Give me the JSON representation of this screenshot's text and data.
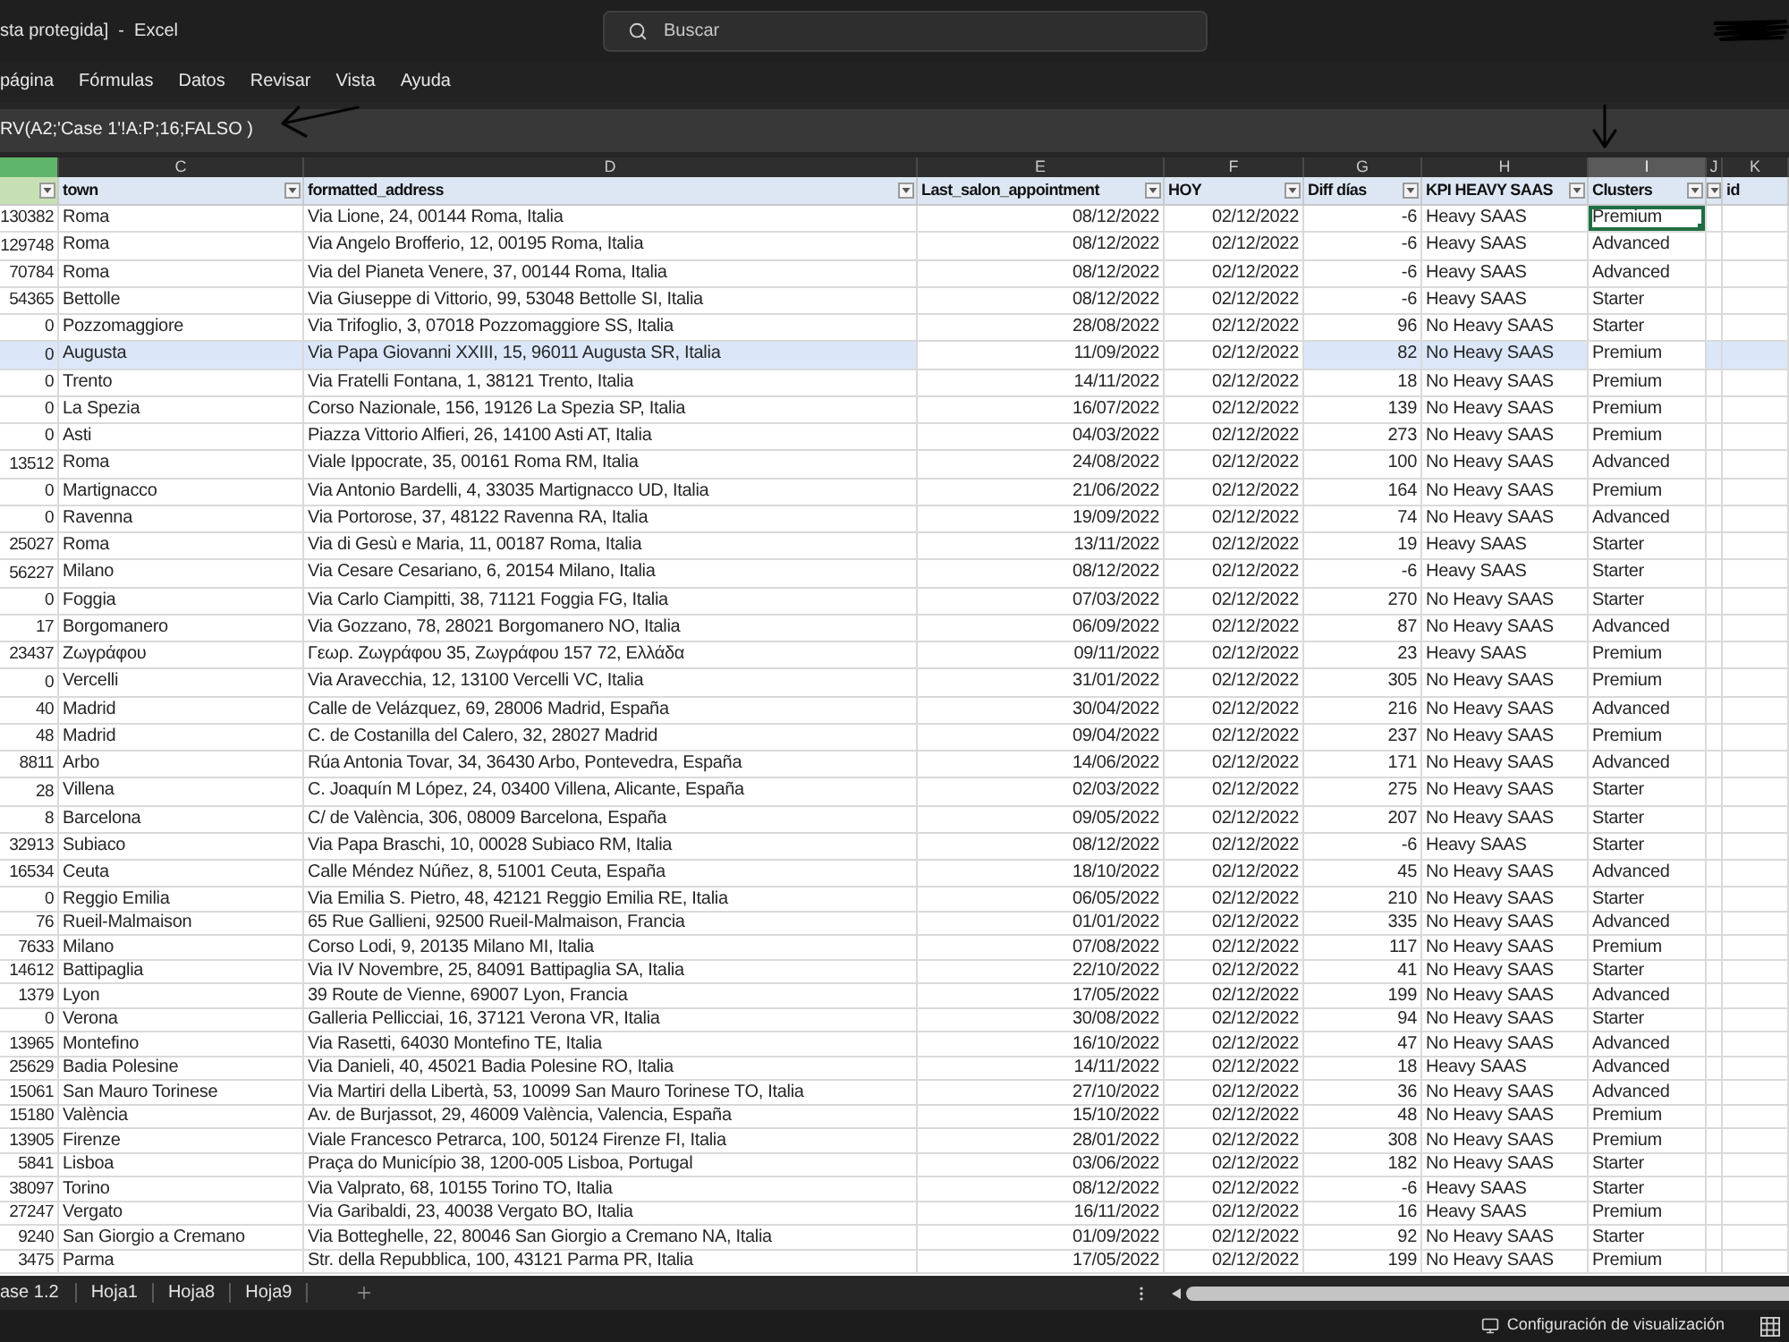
{
  "window": {
    "title": "sta protegida]  -  Excel"
  },
  "search": {
    "placeholder": "Buscar"
  },
  "menu": [
    "página",
    "Fórmulas",
    "Datos",
    "Revisar",
    "Vista",
    "Ayuda"
  ],
  "formula_bar": {
    "value": "RV(A2;'Case 1'!A:P;16;FALSO )"
  },
  "column_headers": [
    {
      "color": "#5fb56a",
      "selected": false
    },
    {
      "letter": "C",
      "selected": false
    },
    {
      "letter": "D",
      "selected": false
    },
    {
      "letter": "E",
      "selected": false
    },
    {
      "letter": "F",
      "selected": false
    },
    {
      "letter": "G",
      "selected": false
    },
    {
      "letter": "H",
      "selected": false
    },
    {
      "letter": "I",
      "selected": true
    },
    {
      "letter": "J",
      "selected": false
    },
    {
      "letter": "K",
      "selected": false
    }
  ],
  "filter_headers": [
    {
      "color": "#c6e0b4",
      "filter_button": true
    },
    {
      "label": "town",
      "filter_button": true
    },
    {
      "label": "formatted_address",
      "filter_button": true
    },
    {
      "label": "Last_salon_appointment",
      "filter_button": true
    },
    {
      "label": "HOY",
      "filter_button": true
    },
    {
      "label": "Diff días",
      "filter_button": true
    },
    {
      "label": "KPI HEAVY SAAS",
      "filter_button": true
    },
    {
      "label": "Clusters",
      "filter_button": true
    },
    {
      "filter_button": true
    },
    {
      "label": "id",
      "filter_button": false
    }
  ],
  "rows": [
    {
      "cells": [
        "130382",
        "Roma",
        "Via Lione, 24, 00144 Roma, Italia",
        "08/12/2022",
        "02/12/2022",
        "-6",
        "Heavy SAAS",
        "Premium"
      ],
      "highlighted": false,
      "clusters_selected": true
    },
    {
      "cells": [
        "129748",
        "Roma",
        "Via Angelo Brofferio, 12, 00195 Roma, Italia",
        "08/12/2022",
        "02/12/2022",
        "-6",
        "Heavy SAAS",
        "Advanced"
      ],
      "highlighted": false,
      "clusters_selected": false
    },
    {
      "cells": [
        "70784",
        "Roma",
        "Via del Pianeta Venere, 37, 00144 Roma, Italia",
        "08/12/2022",
        "02/12/2022",
        "-6",
        "Heavy SAAS",
        "Advanced"
      ],
      "highlighted": false,
      "clusters_selected": false
    },
    {
      "cells": [
        "54365",
        "Bettolle",
        "Via Giuseppe di Vittorio, 99, 53048 Bettolle SI, Italia",
        "08/12/2022",
        "02/12/2022",
        "-6",
        "Heavy SAAS",
        "Starter"
      ],
      "highlighted": false,
      "clusters_selected": false
    },
    {
      "cells": [
        "0",
        "Pozzomaggiore",
        "Via Trifoglio, 3, 07018 Pozzomaggiore SS, Italia",
        "28/08/2022",
        "02/12/2022",
        "96",
        "No Heavy SAAS",
        "Starter"
      ],
      "highlighted": false,
      "clusters_selected": false
    },
    {
      "cells": [
        "0",
        "Augusta",
        "Via Papa Giovanni XXIII, 15, 96011 Augusta SR, Italia",
        "11/09/2022",
        "02/12/2022",
        "82",
        "No Heavy SAAS",
        "Premium"
      ],
      "highlighted": true,
      "clusters_selected": false
    },
    {
      "cells": [
        "0",
        "Trento",
        "Via Fratelli Fontana, 1, 38121 Trento, Italia",
        "14/11/2022",
        "02/12/2022",
        "18",
        "No Heavy SAAS",
        "Premium"
      ],
      "highlighted": false,
      "clusters_selected": false
    },
    {
      "cells": [
        "0",
        "La Spezia",
        "Corso Nazionale, 156, 19126 La Spezia SP, Italia",
        "16/07/2022",
        "02/12/2022",
        "139",
        "No Heavy SAAS",
        "Premium"
      ],
      "highlighted": false,
      "clusters_selected": false
    },
    {
      "cells": [
        "0",
        "Asti",
        "Piazza Vittorio Alfieri, 26, 14100 Asti AT, Italia",
        "04/03/2022",
        "02/12/2022",
        "273",
        "No Heavy SAAS",
        "Premium"
      ],
      "highlighted": false,
      "clusters_selected": false
    },
    {
      "cells": [
        "13512",
        "Roma",
        "Viale Ippocrate, 35, 00161 Roma RM, Italia",
        "24/08/2022",
        "02/12/2022",
        "100",
        "No Heavy SAAS",
        "Advanced"
      ],
      "highlighted": false,
      "clusters_selected": false
    },
    {
      "cells": [
        "0",
        "Martignacco",
        "Via Antonio Bardelli, 4, 33035 Martignacco UD, Italia",
        "21/06/2022",
        "02/12/2022",
        "164",
        "No Heavy SAAS",
        "Premium"
      ],
      "highlighted": false,
      "clusters_selected": false
    },
    {
      "cells": [
        "0",
        "Ravenna",
        "Via Portorose, 37, 48122 Ravenna RA, Italia",
        "19/09/2022",
        "02/12/2022",
        "74",
        "No Heavy SAAS",
        "Advanced"
      ],
      "highlighted": false,
      "clusters_selected": false
    },
    {
      "cells": [
        "25027",
        "Roma",
        "Via di Gesù e Maria, 11, 00187 Roma, Italia",
        "13/11/2022",
        "02/12/2022",
        "19",
        "Heavy SAAS",
        "Starter"
      ],
      "highlighted": false,
      "clusters_selected": false
    },
    {
      "cells": [
        "56227",
        "Milano",
        "Via Cesare Cesariano, 6, 20154 Milano, Italia",
        "08/12/2022",
        "02/12/2022",
        "-6",
        "Heavy SAAS",
        "Starter"
      ],
      "highlighted": false,
      "clusters_selected": false
    },
    {
      "cells": [
        "0",
        "Foggia",
        "Via Carlo Ciampitti, 38, 71121 Foggia FG, Italia",
        "07/03/2022",
        "02/12/2022",
        "270",
        "No Heavy SAAS",
        "Starter"
      ],
      "highlighted": false,
      "clusters_selected": false
    },
    {
      "cells": [
        "17",
        "Borgomanero",
        "Via Gozzano, 78, 28021 Borgomanero NO, Italia",
        "06/09/2022",
        "02/12/2022",
        "87",
        "No Heavy SAAS",
        "Advanced"
      ],
      "highlighted": false,
      "clusters_selected": false
    },
    {
      "cells": [
        "23437",
        "Ζωγράφου",
        "Γεωρ. Ζωγράφου 35, Ζωγράφου 157 72, Ελλάδα",
        "09/11/2022",
        "02/12/2022",
        "23",
        "Heavy SAAS",
        "Premium"
      ],
      "highlighted": false,
      "clusters_selected": false
    },
    {
      "cells": [
        "0",
        "Vercelli",
        "Via Aravecchia, 12, 13100 Vercelli VC, Italia",
        "31/01/2022",
        "02/12/2022",
        "305",
        "No Heavy SAAS",
        "Premium"
      ],
      "highlighted": false,
      "clusters_selected": false
    },
    {
      "cells": [
        "40",
        "Madrid",
        "Calle de Velázquez, 69, 28006 Madrid, España",
        "30/04/2022",
        "02/12/2022",
        "216",
        "No Heavy SAAS",
        "Advanced"
      ],
      "highlighted": false,
      "clusters_selected": false
    },
    {
      "cells": [
        "48",
        "Madrid",
        "C. de Costanilla del Calero, 32, 28027 Madrid",
        "09/04/2022",
        "02/12/2022",
        "237",
        "No Heavy SAAS",
        "Premium"
      ],
      "highlighted": false,
      "clusters_selected": false
    },
    {
      "cells": [
        "8811",
        "Arbo",
        "Rúa Antonia Tovar, 34, 36430 Arbo, Pontevedra, España",
        "14/06/2022",
        "02/12/2022",
        "171",
        "No Heavy SAAS",
        "Advanced"
      ],
      "highlighted": false,
      "clusters_selected": false
    },
    {
      "cells": [
        "28",
        "Villena",
        "C. Joaquín M López, 24, 03400 Villena, Alicante, España",
        "02/03/2022",
        "02/12/2022",
        "275",
        "No Heavy SAAS",
        "Starter"
      ],
      "highlighted": false,
      "clusters_selected": false
    },
    {
      "cells": [
        "8",
        "Barcelona",
        "C/ de València, 306, 08009 Barcelona, España",
        "09/05/2022",
        "02/12/2022",
        "207",
        "No Heavy SAAS",
        "Starter"
      ],
      "highlighted": false,
      "clusters_selected": false
    },
    {
      "cells": [
        "32913",
        "Subiaco",
        "Via Papa Braschi, 10, 00028 Subiaco RM, Italia",
        "08/12/2022",
        "02/12/2022",
        "-6",
        "Heavy SAAS",
        "Starter"
      ],
      "highlighted": false,
      "clusters_selected": false
    },
    {
      "cells": [
        "16534",
        "Ceuta",
        "Calle Méndez Núñez, 8, 51001 Ceuta, España",
        "18/10/2022",
        "02/12/2022",
        "45",
        "No Heavy SAAS",
        "Advanced"
      ],
      "highlighted": false,
      "clusters_selected": false
    },
    {
      "cells": [
        "0",
        "Reggio Emilia",
        "Via Emilia S. Pietro, 48, 42121 Reggio Emilia RE, Italia",
        "06/05/2022",
        "02/12/2022",
        "210",
        "No Heavy SAAS",
        "Starter"
      ],
      "highlighted": false,
      "clusters_selected": false
    },
    {
      "cells": [
        "76",
        "Rueil-Malmaison",
        "65 Rue Gallieni, 92500 Rueil-Malmaison, Francia",
        "01/01/2022",
        "02/12/2022",
        "335",
        "No Heavy SAAS",
        "Advanced"
      ],
      "highlighted": false,
      "clusters_selected": false
    },
    {
      "cells": [
        "7633",
        "Milano",
        "Corso Lodi, 9, 20135 Milano MI, Italia",
        "07/08/2022",
        "02/12/2022",
        "117",
        "No Heavy SAAS",
        "Premium"
      ],
      "highlighted": false,
      "clusters_selected": false
    },
    {
      "cells": [
        "14612",
        "Battipaglia",
        "Via IV Novembre, 25, 84091 Battipaglia SA, Italia",
        "22/10/2022",
        "02/12/2022",
        "41",
        "No Heavy SAAS",
        "Starter"
      ],
      "highlighted": false,
      "clusters_selected": false
    },
    {
      "cells": [
        "1379",
        "Lyon",
        "39 Route de Vienne, 69007 Lyon, Francia",
        "17/05/2022",
        "02/12/2022",
        "199",
        "No Heavy SAAS",
        "Advanced"
      ],
      "highlighted": false,
      "clusters_selected": false
    },
    {
      "cells": [
        "0",
        "Verona",
        "Galleria Pellicciai, 16, 37121 Verona VR, Italia",
        "30/08/2022",
        "02/12/2022",
        "94",
        "No Heavy SAAS",
        "Starter"
      ],
      "highlighted": false,
      "clusters_selected": false
    },
    {
      "cells": [
        "13965",
        "Montefino",
        "Via Rasetti, 64030 Montefino TE, Italia",
        "16/10/2022",
        "02/12/2022",
        "47",
        "No Heavy SAAS",
        "Advanced"
      ],
      "highlighted": false,
      "clusters_selected": false
    },
    {
      "cells": [
        "25629",
        "Badia Polesine",
        "Via Danieli, 40, 45021 Badia Polesine RO, Italia",
        "14/11/2022",
        "02/12/2022",
        "18",
        "Heavy SAAS",
        "Advanced"
      ],
      "highlighted": false,
      "clusters_selected": false
    },
    {
      "cells": [
        "15061",
        "San Mauro Torinese",
        "Via Martiri della Libertà, 53, 10099 San Mauro Torinese TO, Italia",
        "27/10/2022",
        "02/12/2022",
        "36",
        "No Heavy SAAS",
        "Advanced"
      ],
      "highlighted": false,
      "clusters_selected": false
    },
    {
      "cells": [
        "15180",
        "València",
        "Av. de Burjassot, 29, 46009 València, Valencia, España",
        "15/10/2022",
        "02/12/2022",
        "48",
        "No Heavy SAAS",
        "Premium"
      ],
      "highlighted": false,
      "clusters_selected": false
    },
    {
      "cells": [
        "13905",
        "Firenze",
        "Viale Francesco Petrarca, 100, 50124 Firenze FI, Italia",
        "28/01/2022",
        "02/12/2022",
        "308",
        "No Heavy SAAS",
        "Premium"
      ],
      "highlighted": false,
      "clusters_selected": false
    },
    {
      "cells": [
        "5841",
        "Lisboa",
        "Praça do Município 38, 1200-005 Lisboa, Portugal",
        "03/06/2022",
        "02/12/2022",
        "182",
        "No Heavy SAAS",
        "Starter"
      ],
      "highlighted": false,
      "clusters_selected": false
    },
    {
      "cells": [
        "38097",
        "Torino",
        "Via Valprato, 68, 10155 Torino TO, Italia",
        "08/12/2022",
        "02/12/2022",
        "-6",
        "Heavy SAAS",
        "Starter"
      ],
      "highlighted": false,
      "clusters_selected": false
    },
    {
      "cells": [
        "27247",
        "Vergato",
        "Via Garibaldi, 23, 40038 Vergato BO, Italia",
        "16/11/2022",
        "02/12/2022",
        "16",
        "Heavy SAAS",
        "Premium"
      ],
      "highlighted": false,
      "clusters_selected": false
    },
    {
      "cells": [
        "9240",
        "San Giorgio a Cremano",
        "Via Botteghelle, 22, 80046 San Giorgio a Cremano NA, Italia",
        "01/09/2022",
        "02/12/2022",
        "92",
        "No Heavy SAAS",
        "Starter"
      ],
      "highlighted": false,
      "clusters_selected": false
    },
    {
      "cells": [
        "3475",
        "Parma",
        "Str. della Repubblica, 100, 43121 Parma PR, Italia",
        "17/05/2022",
        "02/12/2022",
        "199",
        "No Heavy SAAS",
        "Premium"
      ],
      "highlighted": false,
      "clusters_selected": false
    }
  ],
  "sheet_tabs": [
    "ase 1.2",
    "Hoja1",
    "Hoja8",
    "Hoja9"
  ],
  "status_bar": {
    "display_settings": "Configuración de visualización"
  }
}
